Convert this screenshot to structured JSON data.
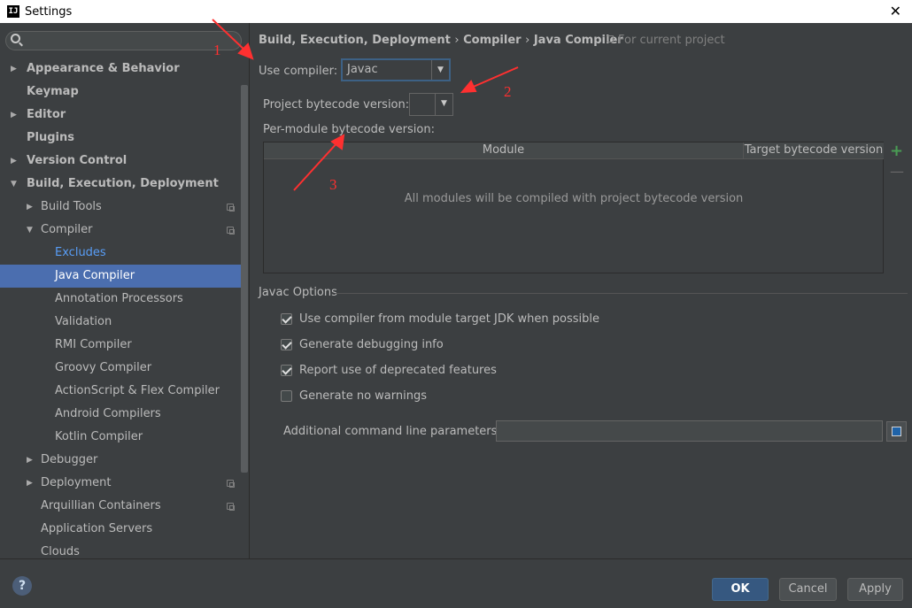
{
  "window": {
    "title": "Settings",
    "close_glyph": "✕",
    "app_icon": "IJ"
  },
  "search": {
    "placeholder": "",
    "icon": "search-icon"
  },
  "sidebar": {
    "items": [
      {
        "label": "Appearance & Behavior",
        "bold": true,
        "level": 0,
        "arrow": "right",
        "project": false
      },
      {
        "label": "Keymap",
        "bold": true,
        "level": 0,
        "arrow": "none",
        "project": false
      },
      {
        "label": "Editor",
        "bold": true,
        "level": 0,
        "arrow": "right",
        "project": false
      },
      {
        "label": "Plugins",
        "bold": true,
        "level": 0,
        "arrow": "none",
        "project": false
      },
      {
        "label": "Version Control",
        "bold": true,
        "level": 0,
        "arrow": "right",
        "project": false
      },
      {
        "label": "Build, Execution, Deployment",
        "bold": true,
        "level": 0,
        "arrow": "down",
        "project": false
      },
      {
        "label": "Build Tools",
        "bold": false,
        "level": 1,
        "arrow": "right",
        "project": true
      },
      {
        "label": "Compiler",
        "bold": false,
        "level": 1,
        "arrow": "down",
        "project": true
      },
      {
        "label": "Excludes",
        "bold": false,
        "level": 2,
        "arrow": "none",
        "project": false,
        "link": true
      },
      {
        "label": "Java Compiler",
        "bold": false,
        "level": 2,
        "arrow": "none",
        "project": false,
        "selected": true
      },
      {
        "label": "Annotation Processors",
        "bold": false,
        "level": 2,
        "arrow": "none",
        "project": false
      },
      {
        "label": "Validation",
        "bold": false,
        "level": 2,
        "arrow": "none",
        "project": false
      },
      {
        "label": "RMI Compiler",
        "bold": false,
        "level": 2,
        "arrow": "none",
        "project": false
      },
      {
        "label": "Groovy Compiler",
        "bold": false,
        "level": 2,
        "arrow": "none",
        "project": false
      },
      {
        "label": "ActionScript & Flex Compiler",
        "bold": false,
        "level": 2,
        "arrow": "none",
        "project": false
      },
      {
        "label": "Android Compilers",
        "bold": false,
        "level": 2,
        "arrow": "none",
        "project": false
      },
      {
        "label": "Kotlin Compiler",
        "bold": false,
        "level": 2,
        "arrow": "none",
        "project": false
      },
      {
        "label": "Debugger",
        "bold": false,
        "level": 1,
        "arrow": "right",
        "project": false
      },
      {
        "label": "Deployment",
        "bold": false,
        "level": 1,
        "arrow": "right",
        "project": true
      },
      {
        "label": "Arquillian Containers",
        "bold": false,
        "level": 1,
        "arrow": "none",
        "project": true
      },
      {
        "label": "Application Servers",
        "bold": false,
        "level": 1,
        "arrow": "none",
        "project": false
      },
      {
        "label": "Clouds",
        "bold": false,
        "level": 1,
        "arrow": "none",
        "project": false
      }
    ]
  },
  "breadcrumb": {
    "parts": [
      "Build, Execution, Deployment",
      "Compiler",
      "Java Compiler"
    ],
    "separator": "›",
    "scope": "For current project"
  },
  "compiler": {
    "use_compiler_label": "Use compiler:",
    "use_compiler_value": "Javac",
    "bytecode_label": "Project bytecode version:",
    "bytecode_value": "",
    "per_module_label": "Per-module bytecode version:"
  },
  "module_table": {
    "columns": [
      "Module",
      "Target bytecode version"
    ],
    "empty_text": "All modules will be compiled with project bytecode version",
    "add_glyph": "+",
    "remove_glyph": "—"
  },
  "javac_options": {
    "title": "Javac Options",
    "checkboxes": [
      {
        "label": "Use compiler from module target JDK when possible",
        "checked": true
      },
      {
        "label": "Generate debugging info",
        "checked": true
      },
      {
        "label": "Report use of deprecated features",
        "checked": true
      },
      {
        "label": "Generate no warnings",
        "checked": false
      }
    ],
    "params_label": "Additional command line parameters:",
    "params_value": ""
  },
  "footer": {
    "help_glyph": "?",
    "ok": "OK",
    "cancel": "Cancel",
    "apply": "Apply"
  },
  "annotations": {
    "labels": [
      "1",
      "2",
      "3"
    ],
    "color": "#ff3030"
  },
  "colors": {
    "background": "#3c3f41",
    "selection": "#4b6eaf",
    "link": "#589df6",
    "accent_ok": "#365880"
  }
}
